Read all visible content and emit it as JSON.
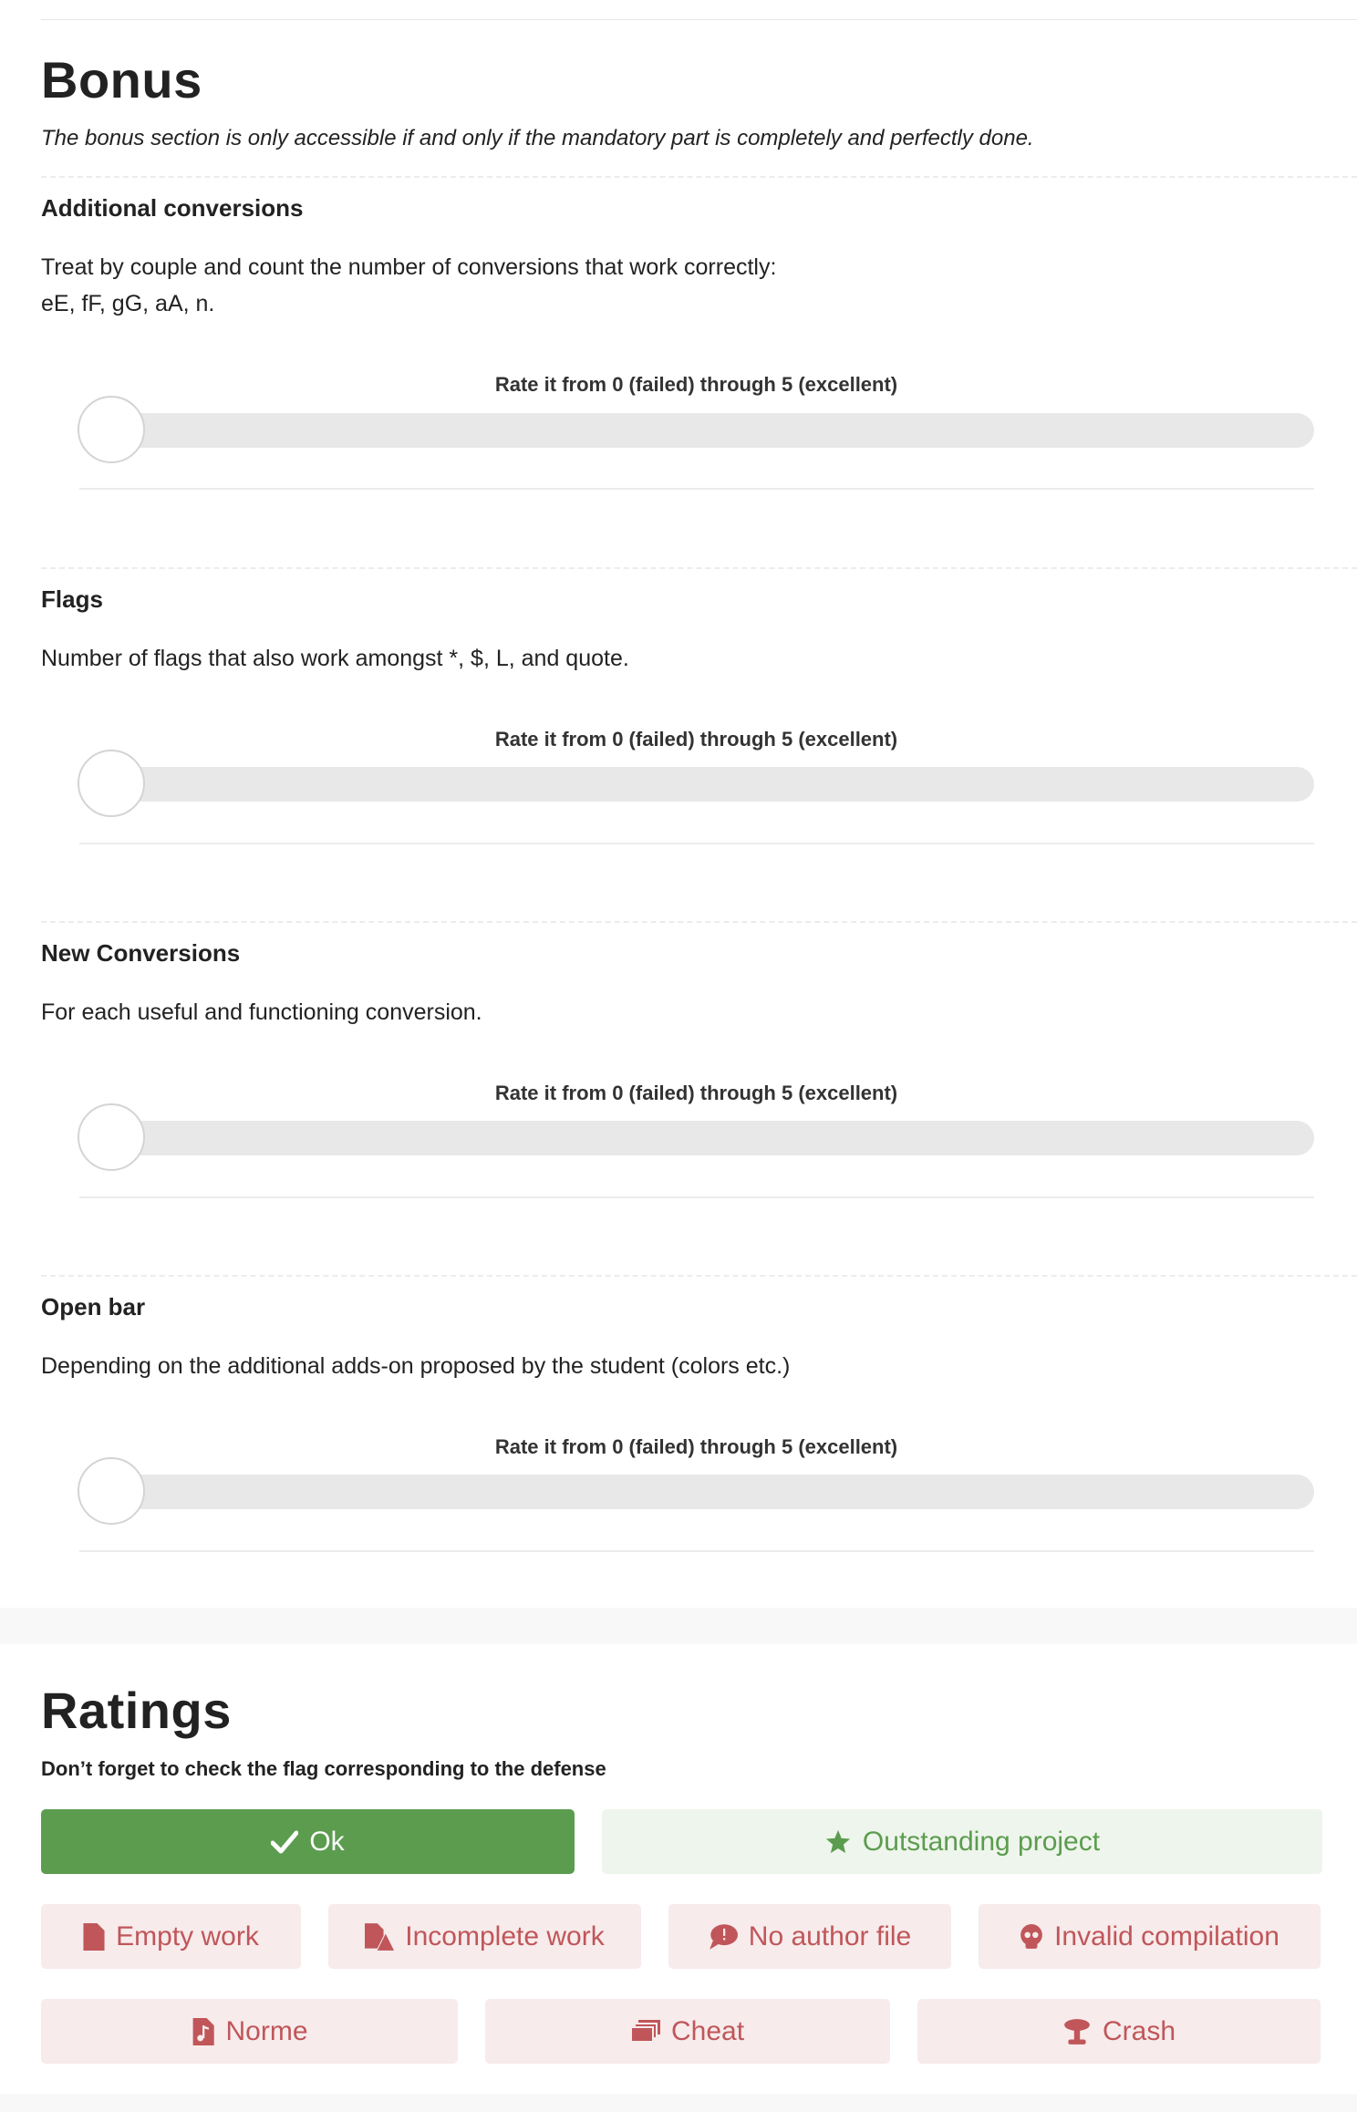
{
  "bonus": {
    "title": "Bonus",
    "subtitle": "The bonus section is only accessible if and only if the mandatory part is completely and perfectly done."
  },
  "sections": [
    {
      "title": "Additional conversions",
      "description_lines": [
        "Treat by couple and count the number of conversions that work correctly:",
        "eE, fF, gG, aA, n."
      ],
      "rate_label": "Rate it from 0 (failed) through 5 (excellent)",
      "rating": 0
    },
    {
      "title": "Flags",
      "description_lines": [
        "Number of flags that also work amongst *, $, L, and quote."
      ],
      "rate_label": "Rate it from 0 (failed) through 5 (excellent)",
      "rating": 0
    },
    {
      "title": "New Conversions",
      "description_lines": [
        "For each useful and functioning conversion."
      ],
      "rate_label": "Rate it from 0 (failed) through 5 (excellent)",
      "rating": 0
    },
    {
      "title": "Open bar",
      "description_lines": [
        "Depending on the additional adds-on proposed by the student (colors etc.)"
      ],
      "rate_label": "Rate it from 0 (failed) through 5 (excellent)",
      "rating": 0
    }
  ],
  "ratings": {
    "title": "Ratings",
    "subtitle": "Don’t forget to check the flag corresponding to the defense",
    "buttons": {
      "ok": {
        "label": "Ok",
        "icon": "check-icon"
      },
      "outstanding": {
        "label": "Outstanding project",
        "icon": "star-icon"
      },
      "empty": {
        "label": "Empty work",
        "icon": "file-icon"
      },
      "incomplete": {
        "label": "Incomplete work",
        "icon": "file-warning-icon"
      },
      "no_author": {
        "label": "No author file",
        "icon": "speech-bubble-icon"
      },
      "invalid": {
        "label": "Invalid compilation",
        "icon": "skull-icon"
      },
      "norme": {
        "label": "Norme",
        "icon": "music-file-icon"
      },
      "cheat": {
        "label": "Cheat",
        "icon": "stacked-cards-icon"
      },
      "crash": {
        "label": "Crash",
        "icon": "explosion-icon"
      }
    }
  },
  "colors": {
    "ok_bg": "#5c9c4f",
    "outstanding_bg": "#eef5ec",
    "flag_bg": "#f7ebeb",
    "flag_text": "#c0565a",
    "slider_track": "#e8e8e8"
  }
}
